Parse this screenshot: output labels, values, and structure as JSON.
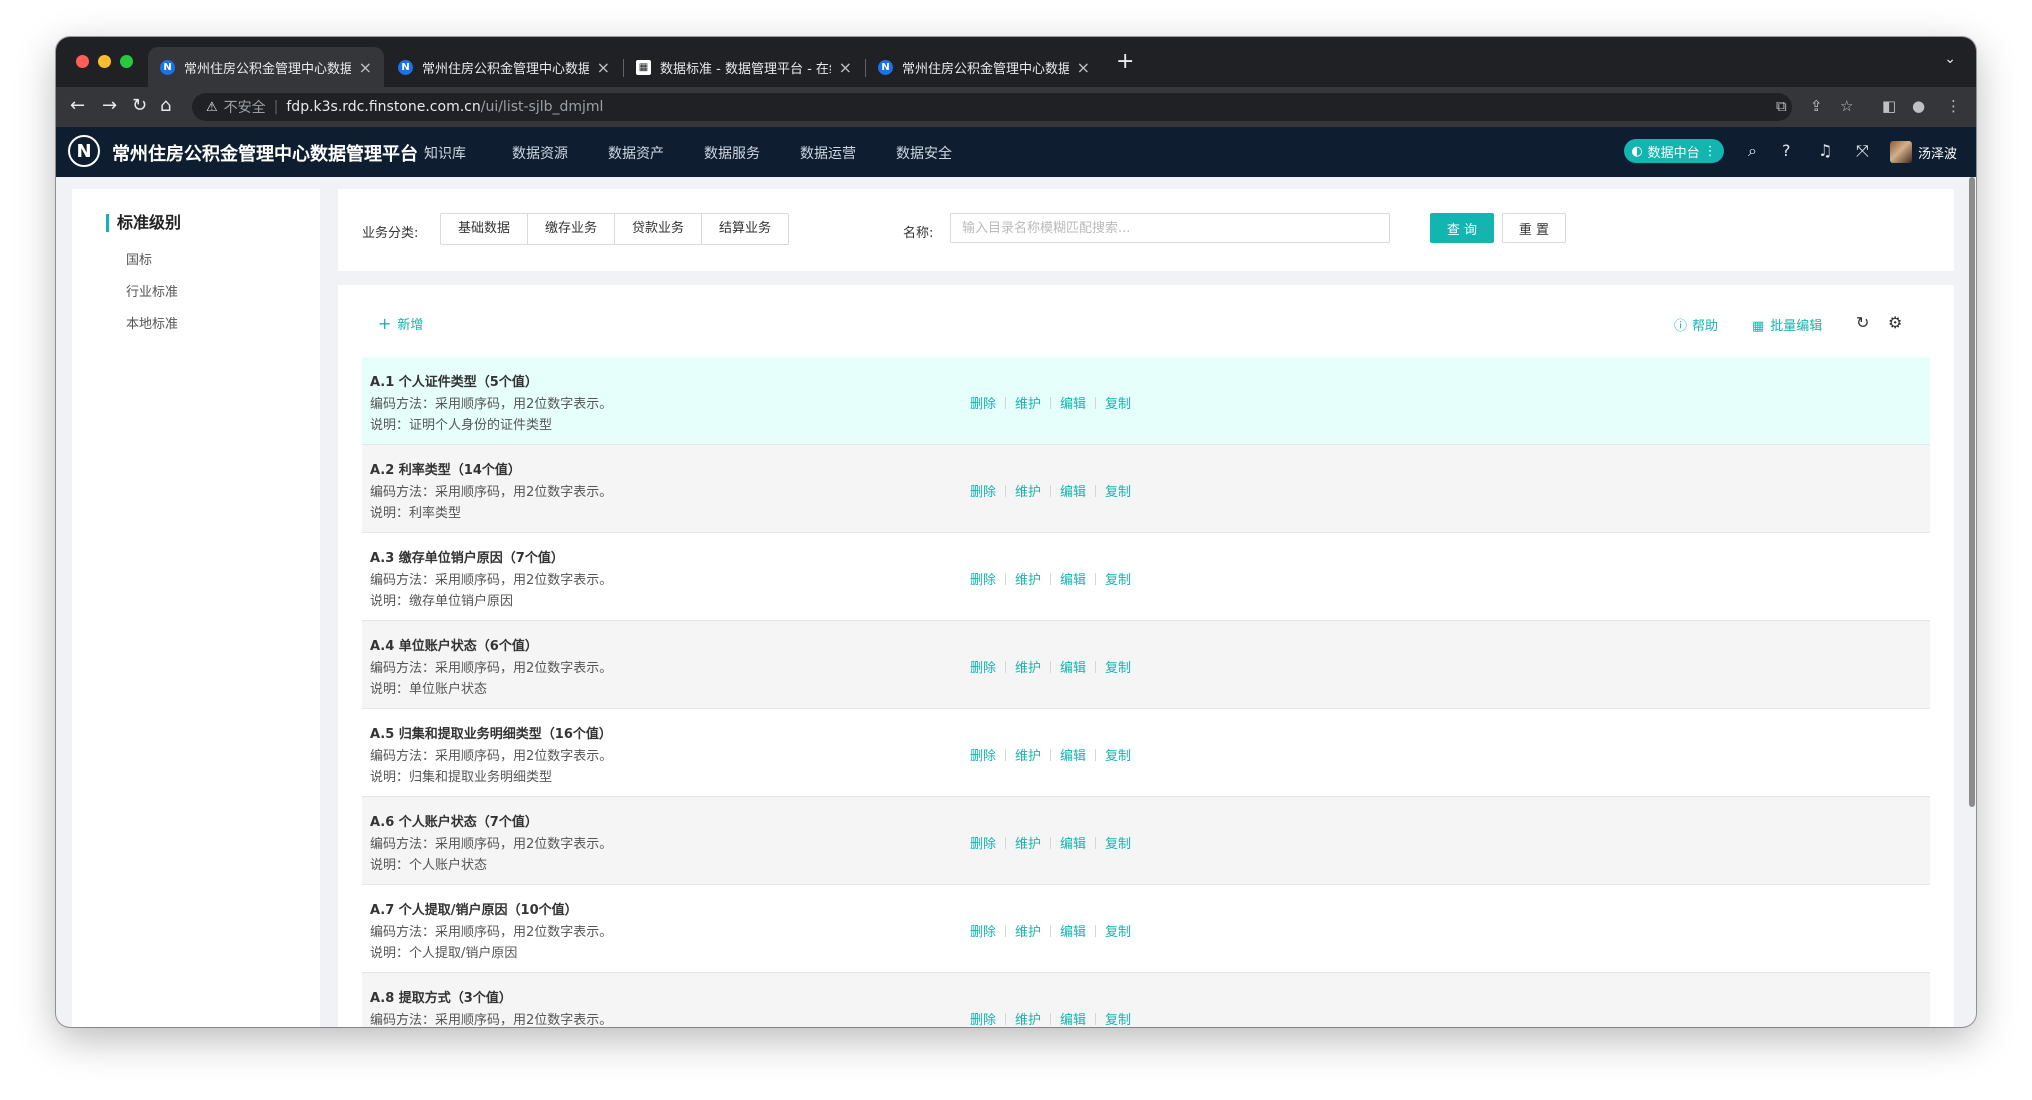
{
  "browser": {
    "tabs": [
      {
        "title": "常州住房公积金管理中心数据管理",
        "favicon": "N",
        "active": true
      },
      {
        "title": "常州住房公积金管理中心数据管理",
        "favicon": "N",
        "active": false
      },
      {
        "title": "数据标准 - 数据管理平台 - 在线",
        "favicon": "doc",
        "active": false
      },
      {
        "title": "常州住房公积金管理中心数据管理",
        "favicon": "N",
        "active": false
      }
    ],
    "new_tab": "+",
    "address": {
      "security": "不安全",
      "host": "fdp.k3s.rdc.finstone.com.cn",
      "path": "/ui/list-sjlb_dmjml"
    }
  },
  "header": {
    "logo": "N",
    "title": "常州住房公积金管理中心数据管理平台",
    "menu": [
      "知识库",
      "数据资源",
      "数据资产",
      "数据服务",
      "数据运营",
      "数据安全"
    ],
    "data_center": "数据中台",
    "user": "汤泽波"
  },
  "sidebar": {
    "title": "标准级别",
    "items": [
      "国标",
      "行业标准",
      "本地标准"
    ]
  },
  "filter": {
    "category_label": "业务分类:",
    "categories": [
      "基础数据",
      "缴存业务",
      "贷款业务",
      "结算业务"
    ],
    "name_label": "名称:",
    "search_placeholder": "输入目录名称模糊匹配搜索...",
    "query": "查 询",
    "reset": "重 置"
  },
  "list": {
    "add": "新增",
    "help": "帮助",
    "batch_edit": "批量编辑",
    "ops": [
      "删除",
      "维护",
      "编辑",
      "复制"
    ],
    "rows": [
      {
        "title": "A.1 个人证件类型（5个值）",
        "method": "编码方法：采用顺序码，用2位数字表示。",
        "desc": "说明：证明个人身份的证件类型"
      },
      {
        "title": "A.2 利率类型（14个值）",
        "method": "编码方法：采用顺序码，用2位数字表示。",
        "desc": "说明：利率类型"
      },
      {
        "title": "A.3 缴存单位销户原因（7个值）",
        "method": "编码方法：采用顺序码，用2位数字表示。",
        "desc": "说明：缴存单位销户原因"
      },
      {
        "title": "A.4 单位账户状态（6个值）",
        "method": "编码方法：采用顺序码，用2位数字表示。",
        "desc": "说明：单位账户状态"
      },
      {
        "title": "A.5 归集和提取业务明细类型（16个值）",
        "method": "编码方法：采用顺序码，用2位数字表示。",
        "desc": "说明：归集和提取业务明细类型"
      },
      {
        "title": "A.6 个人账户状态（7个值）",
        "method": "编码方法：采用顺序码，用2位数字表示。",
        "desc": "说明：个人账户状态"
      },
      {
        "title": "A.7 个人提取/销户原因（10个值）",
        "method": "编码方法：采用顺序码，用2位数字表示。",
        "desc": "说明：个人提取/销户原因"
      },
      {
        "title": "A.8 提取方式（3个值）",
        "method": "编码方法：采用顺序码，用2位数字表示。",
        "desc": ""
      }
    ]
  },
  "colors": {
    "accent": "#13b5b1",
    "header_bg": "#0e1e30",
    "highlight_row": "#e6fffb"
  }
}
